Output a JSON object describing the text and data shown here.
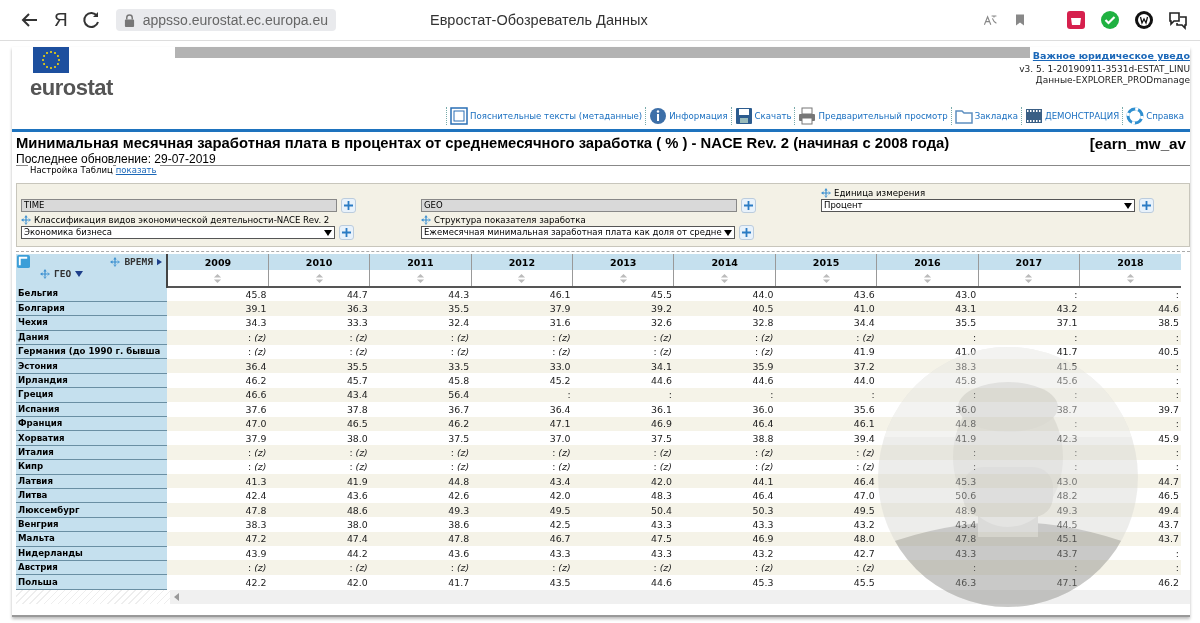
{
  "browser": {
    "logo": "Я",
    "url": "appsso.eurostat.ec.europa.eu",
    "page_title": "Евростат-Обозреватель Данных"
  },
  "header": {
    "logo": "eurostat",
    "legal_link": "Важное юридическое уведо",
    "version_lines": [
      "v3. 5. 1-20190911-3531d-ESTAT_LINU",
      "Данные-EXPLORER_PRODmanage"
    ],
    "toolbar": [
      {
        "kind": "metadata",
        "label": "Пояснительные тексты (метаданные)"
      },
      {
        "kind": "info",
        "label": "Информация"
      },
      {
        "kind": "download",
        "label": "Скачать"
      },
      {
        "kind": "preview",
        "label": "Предварительный просмотр"
      },
      {
        "kind": "bookmark",
        "label": "Закладка"
      },
      {
        "kind": "demo",
        "label": "ДЕМОНСТРАЦИЯ"
      },
      {
        "kind": "help",
        "label": "Справка"
      }
    ]
  },
  "title": "Минимальная месячная заработная плата в процентах от среднемесячного заработка ( % ) - NACE Rev. 2 (начиная с 2008 года)",
  "dataset_code": "[earn_mw_av",
  "updated": "Последнее обновление: 29-07-2019",
  "settings": {
    "label": "Настройка Таблиц",
    "link": "показать"
  },
  "filters": [
    {
      "kind": "fixed",
      "value": "TIME"
    },
    {
      "kind": "fixed",
      "value": "GEO"
    },
    {
      "kind": "select",
      "label": "Единица измерения",
      "value": "Процент"
    },
    {
      "kind": "select",
      "label": "Классификация видов экономической деятельности-NACE Rev. 2",
      "value": "Экономика бизнеса"
    },
    {
      "kind": "select",
      "label": "Структура показателя заработка",
      "value": "Ежемесячная минимальная заработная плата как доля от средне"
    }
  ],
  "table": {
    "time_axis": "ВРЕМЯ",
    "geo_axis": "ГЕО",
    "columns": [
      "2009",
      "2010",
      "2011",
      "2012",
      "2013",
      "2014",
      "2015",
      "2016",
      "2017",
      "2018"
    ],
    "rows": [
      {
        "label": "Бельгия",
        "values": [
          "45.8",
          "44.7",
          "44.3",
          "46.1",
          "45.5",
          "44.0",
          "43.6",
          "43.0",
          ":",
          ":"
        ]
      },
      {
        "label": "Болгария",
        "values": [
          "39.1",
          "36.3",
          "35.5",
          "37.9",
          "39.2",
          "40.5",
          "41.0",
          "43.1",
          "43.2",
          "44.6"
        ]
      },
      {
        "label": "Чехия",
        "values": [
          "34.3",
          "33.3",
          "32.4",
          "31.6",
          "32.6",
          "32.8",
          "34.4",
          "35.5",
          "37.1",
          "38.5"
        ]
      },
      {
        "label": "Дания",
        "values": [
          ": *(z)*",
          ": *(z)*",
          ": *(z)*",
          ": *(z)*",
          ": *(z)*",
          ": *(z)*",
          ": *(z)*",
          ":",
          ":",
          ":"
        ]
      },
      {
        "label": "Германия (до 1990 г. бывша",
        "values": [
          ": *(z)*",
          ": *(z)*",
          ": *(z)*",
          ": *(z)*",
          ": *(z)*",
          ": *(z)*",
          "41.9",
          "41.0",
          "41.7",
          "40.5"
        ]
      },
      {
        "label": "Эстония",
        "values": [
          "36.4",
          "35.5",
          "33.5",
          "33.0",
          "34.1",
          "35.9",
          "37.2",
          "38.3",
          "41.5",
          ":"
        ]
      },
      {
        "label": "Ирландия",
        "values": [
          "46.2",
          "45.7",
          "45.8",
          "45.2",
          "44.6",
          "44.6",
          "44.0",
          "45.8",
          "45.6",
          ":"
        ]
      },
      {
        "label": "Греция",
        "values": [
          "46.6",
          "43.4",
          "56.4",
          ":",
          ":",
          ":",
          ":",
          ":",
          ":",
          ":"
        ]
      },
      {
        "label": "Испания",
        "values": [
          "37.6",
          "37.8",
          "36.7",
          "36.4",
          "36.1",
          "36.0",
          "35.6",
          "36.0",
          "38.7",
          "39.7"
        ]
      },
      {
        "label": "Франция",
        "values": [
          "47.0",
          "46.5",
          "46.2",
          "47.1",
          "46.9",
          "46.4",
          "46.1",
          "44.8",
          ":",
          ":"
        ]
      },
      {
        "label": "Хорватия",
        "values": [
          "37.9",
          "38.0",
          "37.5",
          "37.0",
          "37.5",
          "38.8",
          "39.4",
          "41.9",
          "42.3",
          "45.9"
        ]
      },
      {
        "label": "Италия",
        "values": [
          ": *(z)*",
          ": *(z)*",
          ": *(z)*",
          ": *(z)*",
          ": *(z)*",
          ": *(z)*",
          ": *(z)*",
          ":",
          ":",
          ":"
        ]
      },
      {
        "label": "Кипр",
        "values": [
          ": *(z)*",
          ": *(z)*",
          ": *(z)*",
          ": *(z)*",
          ": *(z)*",
          ": *(z)*",
          ": *(z)*",
          ":",
          ":",
          ":"
        ]
      },
      {
        "label": "Латвия",
        "values": [
          "41.3",
          "41.9",
          "44.8",
          "43.4",
          "42.0",
          "44.1",
          "46.4",
          "45.3",
          "43.0",
          "44.7"
        ]
      },
      {
        "label": "Литва",
        "values": [
          "42.4",
          "43.6",
          "42.6",
          "42.0",
          "48.3",
          "46.4",
          "47.0",
          "50.6",
          "48.2",
          "46.5"
        ]
      },
      {
        "label": "Люксембург",
        "values": [
          "47.8",
          "48.6",
          "49.3",
          "49.5",
          "50.4",
          "50.3",
          "49.5",
          "48.9",
          "49.3",
          "49.4"
        ]
      },
      {
        "label": "Венгрия",
        "values": [
          "38.3",
          "38.0",
          "38.6",
          "42.5",
          "43.3",
          "43.3",
          "43.2",
          "43.4",
          "44.5",
          "43.7"
        ]
      },
      {
        "label": "Мальта",
        "values": [
          "47.2",
          "47.4",
          "47.8",
          "46.7",
          "47.5",
          "46.9",
          "48.0",
          "47.8",
          "45.1",
          "43.7"
        ]
      },
      {
        "label": "Нидерланды",
        "values": [
          "43.9",
          "44.2",
          "43.6",
          "43.3",
          "43.3",
          "43.2",
          "42.7",
          "43.3",
          "43.7",
          ":"
        ]
      },
      {
        "label": "Австрия",
        "values": [
          ": *(z)*",
          ": *(z)*",
          ": *(z)*",
          ": *(z)*",
          ": *(z)*",
          ": *(z)*",
          ": *(z)*",
          ":",
          ":",
          ":"
        ]
      },
      {
        "label": "Польша",
        "values": [
          "42.2",
          "42.0",
          "41.7",
          "43.5",
          "44.6",
          "45.3",
          "45.5",
          "46.3",
          "47.1",
          "46.2"
        ]
      }
    ]
  }
}
